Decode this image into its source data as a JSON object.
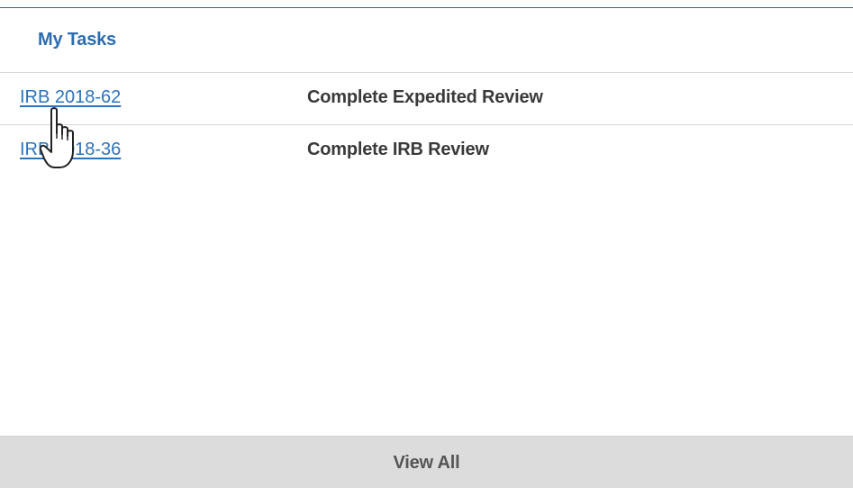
{
  "panel": {
    "title": "My Tasks"
  },
  "tasks": [
    {
      "id": "IRB 2018-62",
      "description": "Complete Expedited Review"
    },
    {
      "id": "IRB 2018-36",
      "description": "Complete IRB Review"
    }
  ],
  "footer": {
    "view_all_label": "View All"
  },
  "cursor": {
    "icon": "hand-pointer-icon"
  },
  "colors": {
    "accent": "#2a6db0",
    "link": "#2a73bd",
    "footer_bg": "#dcdcdc"
  }
}
